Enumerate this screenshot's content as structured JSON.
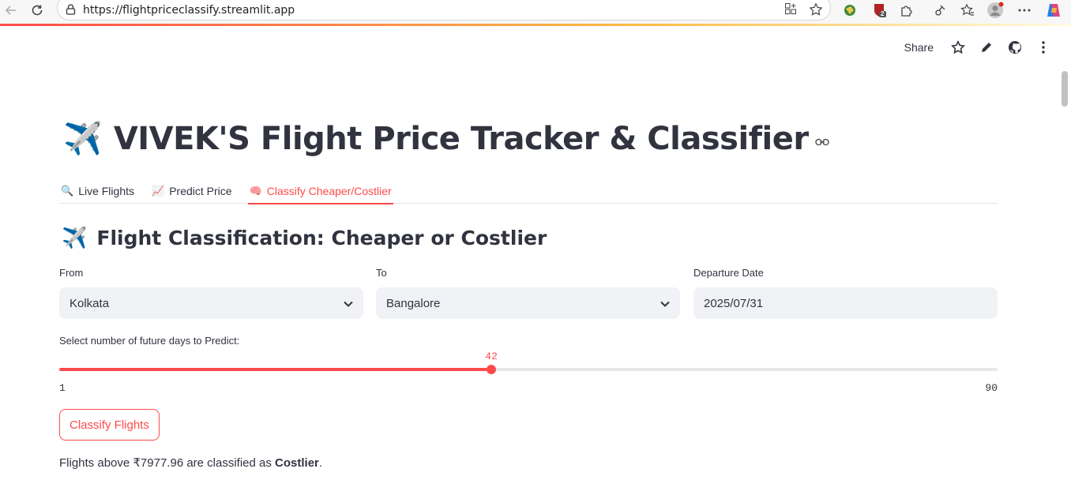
{
  "browser": {
    "url": "https://flightpriceclassify.streamlit.app",
    "extension_badge": "2"
  },
  "header": {
    "share_label": "Share"
  },
  "page": {
    "title_emoji": "✈️",
    "title": "VIVEK'S Flight Price Tracker & Classifier"
  },
  "tabs": [
    {
      "icon": "🔍",
      "label": "Live Flights"
    },
    {
      "icon": "📈",
      "label": "Predict Price"
    },
    {
      "icon": "🧠",
      "label": "Classify Cheaper/Costlier",
      "active": true
    }
  ],
  "section": {
    "icon": "✈️",
    "title": "Flight Classification: Cheaper or Costlier"
  },
  "form": {
    "from_label": "From",
    "from_value": "Kolkata",
    "to_label": "To",
    "to_value": "Bangalore",
    "date_label": "Departure Date",
    "date_value": "2025/07/31"
  },
  "slider": {
    "label": "Select number of future days to Predict:",
    "value": 42,
    "min": 1,
    "max": 90
  },
  "button": {
    "label": "Classify Flights"
  },
  "result": {
    "prefix": "Flights above ",
    "threshold": "₹7977.96",
    "middle": " are classified as ",
    "class": "Costlier",
    "suffix": "."
  },
  "colors": {
    "accent": "#ff4b4b",
    "text": "#31333f",
    "input_bg": "#f0f2f6"
  }
}
